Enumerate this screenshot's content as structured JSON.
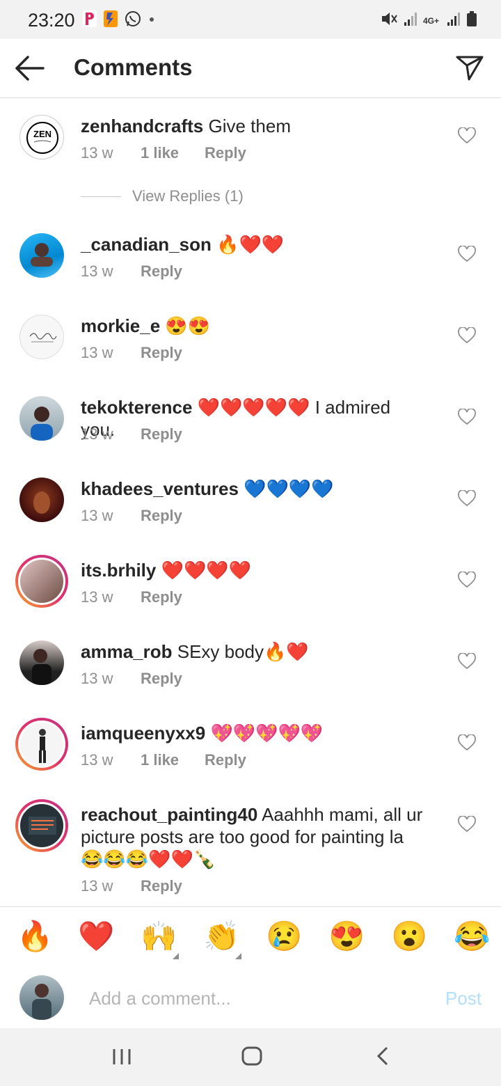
{
  "status_bar": {
    "time": "23:20",
    "network": "4G+",
    "icons": [
      "p-app-icon",
      "bolt-app-icon",
      "whatsapp-icon",
      "dot-icon",
      "mute-icon",
      "signal-icon",
      "signal-icon-2",
      "battery-icon"
    ]
  },
  "header": {
    "title": "Comments",
    "back_icon": "arrow-left-icon",
    "send_icon": "paper-plane-icon"
  },
  "comments": [
    {
      "username": "zenhandcrafts",
      "text": " Give them",
      "time": "13 w",
      "likes": "1 like",
      "reply": "Reply",
      "view_replies": "View Replies (1)"
    },
    {
      "username": "_canadian_son",
      "text": " 🔥❤️❤️",
      "time": "13 w",
      "likes": "",
      "reply": "Reply"
    },
    {
      "username": "morkie_e",
      "text": " 😍😍",
      "time": "13 w",
      "likes": "",
      "reply": "Reply"
    },
    {
      "username": "tekokterence",
      "text": " ❤️❤️❤️❤️❤️ I admired you.",
      "time": "13 w",
      "likes": "",
      "reply": "Reply"
    },
    {
      "username": "khadees_ventures",
      "text": " 💙💙💙💙",
      "time": "13 w",
      "likes": "",
      "reply": "Reply"
    },
    {
      "username": "its.brhily",
      "text": " ❤️❤️❤️❤️",
      "time": "13 w",
      "likes": "",
      "reply": "Reply"
    },
    {
      "username": "amma_rob",
      "text": " SExy body🔥❤️",
      "time": "13 w",
      "likes": "",
      "reply": "Reply"
    },
    {
      "username": "iamqueenyxx9",
      "text": " 💖💖💖💖💖",
      "time": "13 w",
      "likes": "1 like",
      "reply": "Reply"
    },
    {
      "username": "reachout_painting40",
      "text": " Aaahhh mami, all ur picture posts are too good for painting la 😂😂😂❤️❤️🍾",
      "time": "13 w",
      "likes": "",
      "reply": "Reply"
    }
  ],
  "emoji_bar": [
    "🔥",
    "❤️",
    "🙌",
    "👏",
    "😢",
    "😍",
    "😮",
    "😂"
  ],
  "composer": {
    "placeholder": "Add a comment...",
    "post_label": "Post"
  },
  "colors": {
    "accent_post": "#b2dffc",
    "meta_gray": "#8e8e8e",
    "story_ring_start": "#f9a825",
    "story_ring_end": "#c13584"
  }
}
